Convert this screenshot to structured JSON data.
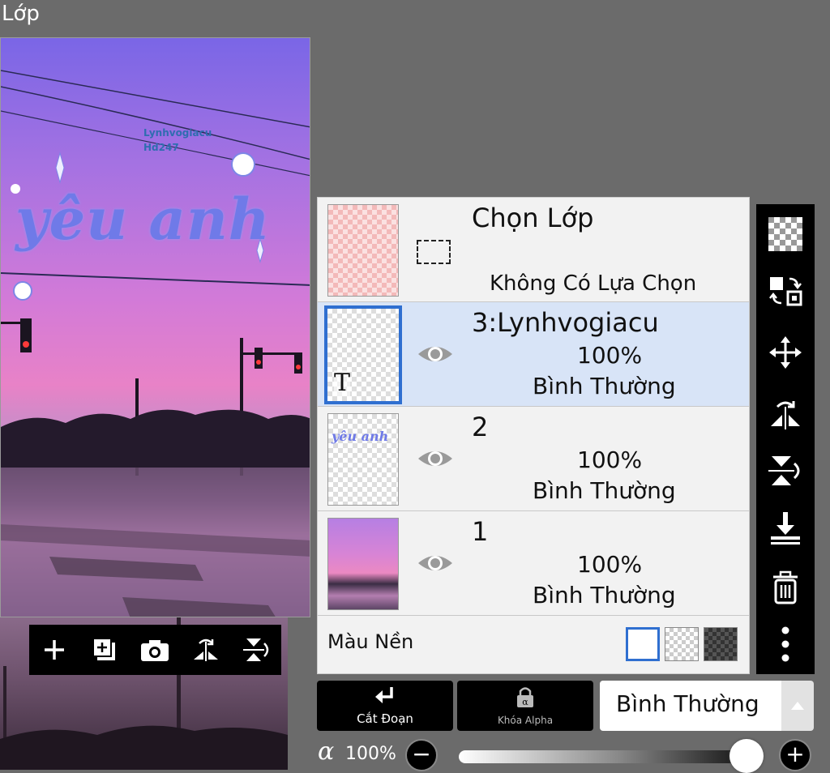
{
  "header": {
    "title": "Lớp"
  },
  "canvas": {
    "watermark_line1": "Lynhvogiacu",
    "watermark_line2": "Hd247",
    "main_text": "yêu anh"
  },
  "canvas_toolbar": {
    "icons": [
      "add-layer-icon",
      "duplicate-layer-icon",
      "camera-icon",
      "flip-horizontal-icon",
      "flip-vertical-icon"
    ]
  },
  "layers": {
    "selection": {
      "name": "Chọn Lớp",
      "status": "Không Có Lựa Chọn"
    },
    "items": [
      {
        "name": "3:Lynhvogiacu",
        "opacity": "100%",
        "blend": "Bình Thường",
        "type": "text",
        "selected": true
      },
      {
        "name": "2",
        "opacity": "100%",
        "blend": "Bình Thường",
        "type": "image",
        "selected": false
      },
      {
        "name": "1",
        "opacity": "100%",
        "blend": "Bình Thường",
        "type": "photo",
        "selected": false
      }
    ],
    "background_color_label": "Màu Nền",
    "layer_2_thumb_text": "yêu anh",
    "layer_3_thumb_glyph": "T"
  },
  "tools": [
    "transparency-icon",
    "transform-icon",
    "move-icon",
    "flip-horizontal-icon",
    "flip-vertical-icon",
    "merge-down-icon",
    "trash-icon",
    "more-icon"
  ],
  "bottom": {
    "cut_label": "Cắt Đoạn",
    "alpha_lock_label": "Khóa Alpha",
    "blend_mode": "Bình Thường",
    "alpha_symbol": "α",
    "opacity_value": "100%",
    "opacity_fraction": 1.0,
    "minus": "−",
    "plus": "+"
  },
  "colors": {
    "selected_accent": "#2f6fd0",
    "toolbar": "#000000",
    "panel": "#f2f2f2"
  }
}
